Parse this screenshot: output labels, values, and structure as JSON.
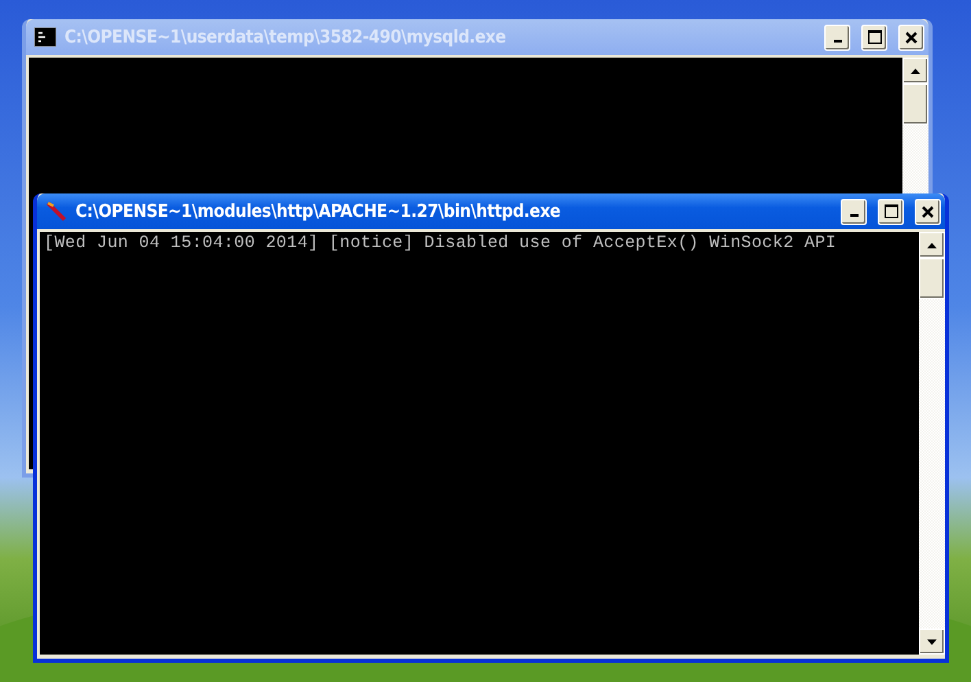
{
  "windows": [
    {
      "kind": "cmd",
      "title": "C:\\OPENSE~1\\userdata\\temp\\3582-490\\mysqld.exe",
      "active": false
    },
    {
      "kind": "apache",
      "title": "C:\\OPENSE~1\\modules\\http\\APACHE~1.27\\bin\\httpd.exe",
      "active": true,
      "lines": [
        "[Wed Jun 04 15:04:00 2014] [notice] Disabled use of AcceptEx() WinSock2 API"
      ]
    }
  ]
}
